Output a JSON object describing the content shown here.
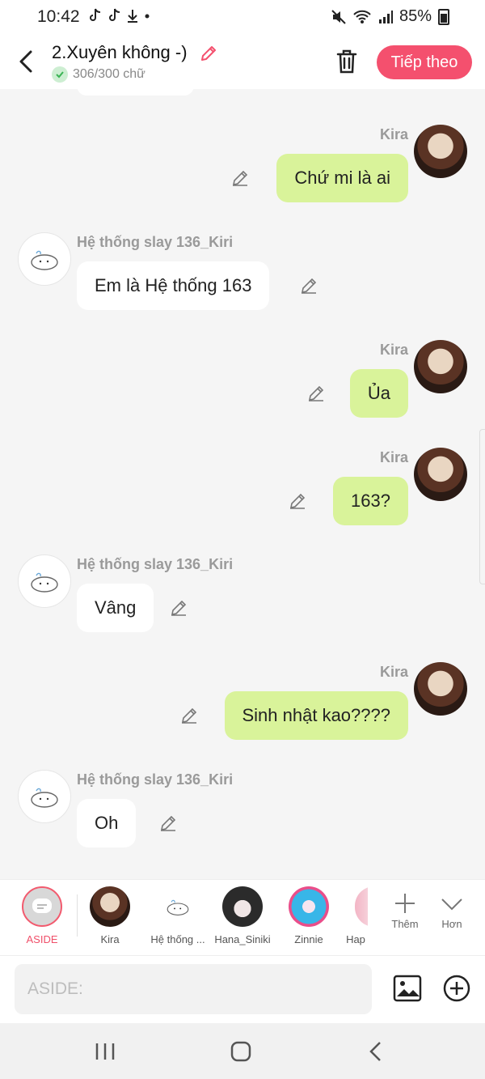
{
  "status_bar": {
    "time": "10:42",
    "battery": "85%"
  },
  "header": {
    "title": "2.Xuyên không -)",
    "word_count": "306/300 chữ",
    "next_label": "Tiếp theo"
  },
  "messages": [
    {
      "side": "right",
      "sender": "Kira",
      "text": "Chứ mi là ai"
    },
    {
      "side": "left",
      "sender": "Hệ thống slay 136_Kiri",
      "text": "Em là Hệ thống 163"
    },
    {
      "side": "right",
      "sender": "Kira",
      "text": "Ủa"
    },
    {
      "side": "right",
      "sender": "Kira",
      "text": "163?"
    },
    {
      "side": "left",
      "sender": "Hệ thống slay 136_Kiri",
      "text": "Vâng"
    },
    {
      "side": "right",
      "sender": "Kira",
      "text": "Sinh nhật kao????"
    },
    {
      "side": "left",
      "sender": "Hệ thống slay 136_Kiri",
      "text": "Oh"
    }
  ],
  "character_bar": {
    "aside_label": "ASIDE",
    "characters": [
      "Kira",
      "Hệ thống ...",
      "Hana_Siniki",
      "Zinnie",
      "Hap"
    ],
    "add_label": "Thêm",
    "more_label": "Hơn"
  },
  "input": {
    "placeholder": "ASIDE:"
  },
  "colors": {
    "accent": "#f4506e",
    "right_bubble": "#d9f39a",
    "left_bubble": "#ffffff"
  },
  "icons": [
    "back-icon",
    "pencil-icon",
    "trash-icon",
    "check-icon",
    "image-icon",
    "plus-circle-icon",
    "plus-icon",
    "chevron-down-icon",
    "recent-apps-icon",
    "home-icon",
    "nav-back-icon"
  ]
}
